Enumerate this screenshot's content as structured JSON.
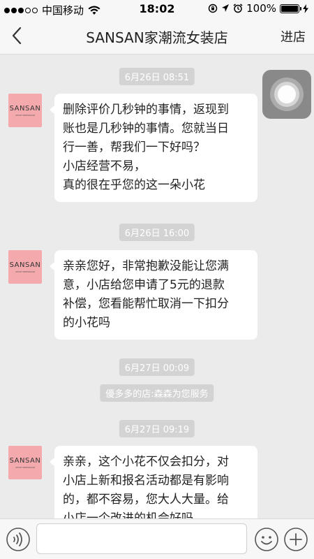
{
  "status_bar": {
    "carrier": "中国移动",
    "time": "18:02",
    "battery": "100%",
    "icons": [
      "signal-dots-icon",
      "wifi-icon",
      "lock-rotation-icon",
      "location-icon",
      "alarm-icon",
      "battery-icon",
      "charging-icon"
    ]
  },
  "nav": {
    "title": "SANSAN家潮流女装店",
    "action": "进店",
    "back_icon": "back-chevron-icon"
  },
  "avatar": {
    "brand": "SANSAN",
    "sub": "SHOP CENTRASAN"
  },
  "messages": [
    {
      "timestamp": "6月26日 08:51",
      "lines": [
        "删除评价几秒钟的事情，返现到",
        "账也是几秒钟的事情。您就当日",
        "行一善，帮我们一下好吗？",
        "小店经营不易，",
        "真的很在乎您的这一朵小花"
      ]
    },
    {
      "timestamp": "6月26日 16:00",
      "lines": [
        "亲亲您好，非常抱歉没能让您满",
        "意，小店给您申请了5元的退款",
        "补偿，您看能帮忙取消一下扣分",
        "的小花吗"
      ]
    },
    {
      "timestamp": "6月27日 00:09",
      "system": "優多多的店:森森为您服务"
    },
    {
      "timestamp": "6月27日 09:19",
      "lines": [
        "亲亲，这个小花不仅会扣分，对",
        "小店上新和报名活动都是有影响",
        "的，都不容易，您大人大量。给",
        "小店一个改进的机会好吗。"
      ]
    }
  ],
  "input_bar": {
    "icons": [
      "voice-icon",
      "emoji-icon",
      "plus-icon"
    ],
    "placeholder": ""
  },
  "colors": {
    "background": "#ebebeb",
    "bar": "#f7f7f7",
    "bubble": "#ffffff",
    "avatar": "#f4a9ad",
    "timestamp_bg": "#d3d3d3"
  }
}
